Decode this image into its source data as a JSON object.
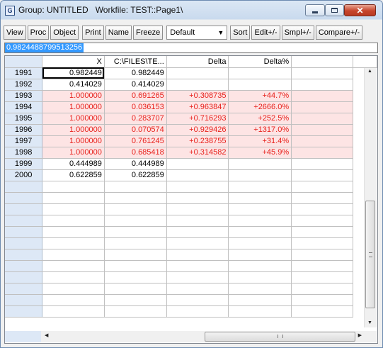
{
  "window": {
    "app_icon": "G",
    "title": "Group: UNTITLED   Workfile: TEST::Page1\\",
    "minimize_icon": "minimize-icon",
    "maximize_icon": "maximize-icon",
    "close_icon": "close-icon"
  },
  "toolbar": {
    "view": "View",
    "proc": "Proc",
    "object": "Object",
    "print": "Print",
    "name": "Name",
    "freeze": "Freeze",
    "display_format": "Default",
    "sort": "Sort",
    "edit": "Edit+/-",
    "smpl": "Smpl+/-",
    "compare": "Compare+/-"
  },
  "cell_editor": {
    "value": "0.9824488799513256"
  },
  "table": {
    "columns": [
      "X",
      "C:\\FILES\\TE...",
      "Delta",
      "Delta%"
    ],
    "rows": [
      {
        "label": "1991",
        "x": "0.982449",
        "c": "0.982449",
        "delta": "",
        "pct": "",
        "highlight": false
      },
      {
        "label": "1992",
        "x": "0.414029",
        "c": "0.414029",
        "delta": "",
        "pct": "",
        "highlight": false
      },
      {
        "label": "1993",
        "x": "1.000000",
        "c": "0.691265",
        "delta": "+0.308735",
        "pct": "+44.7%",
        "highlight": true
      },
      {
        "label": "1994",
        "x": "1.000000",
        "c": "0.036153",
        "delta": "+0.963847",
        "pct": "+2666.0%",
        "highlight": true
      },
      {
        "label": "1995",
        "x": "1.000000",
        "c": "0.283707",
        "delta": "+0.716293",
        "pct": "+252.5%",
        "highlight": true
      },
      {
        "label": "1996",
        "x": "1.000000",
        "c": "0.070574",
        "delta": "+0.929426",
        "pct": "+1317.0%",
        "highlight": true
      },
      {
        "label": "1997",
        "x": "1.000000",
        "c": "0.761245",
        "delta": "+0.238755",
        "pct": "+31.4%",
        "highlight": true
      },
      {
        "label": "1998",
        "x": "1.000000",
        "c": "0.685418",
        "delta": "+0.314582",
        "pct": "+45.9%",
        "highlight": true
      },
      {
        "label": "1999",
        "x": "0.444989",
        "c": "0.444989",
        "delta": "",
        "pct": "",
        "highlight": false
      },
      {
        "label": "2000",
        "x": "0.622859",
        "c": "0.622859",
        "delta": "",
        "pct": "",
        "highlight": false
      }
    ],
    "blank_rows": 12,
    "selected_cell": "1991 / X",
    "highlight_bg": "#fde4e4",
    "highlight_text": "#e8211c"
  },
  "scrollbars": {
    "vertical_up_icon": "arrow-up-icon",
    "vertical_down_icon": "arrow-down-icon",
    "horizontal_left_icon": "arrow-left-icon",
    "horizontal_right_icon": "arrow-right-icon"
  }
}
